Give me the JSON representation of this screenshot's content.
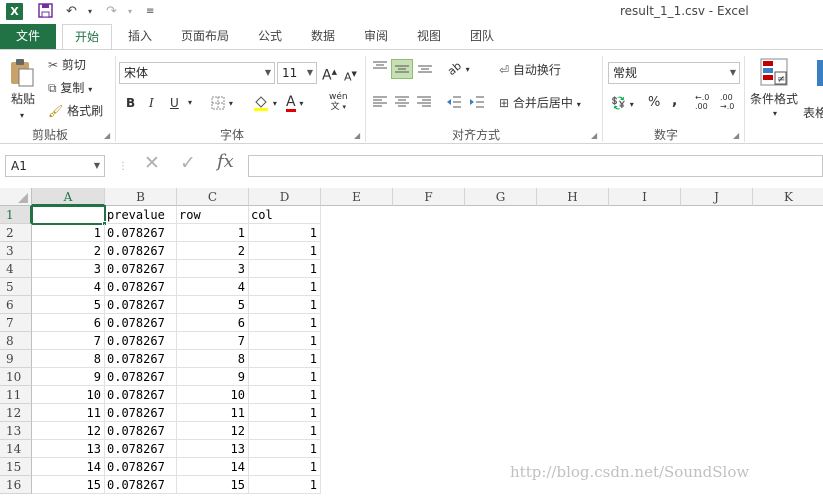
{
  "window_title": "result_1_1.csv - Excel",
  "app_icon": "X",
  "tabs": [
    "文件",
    "开始",
    "插入",
    "页面布局",
    "公式",
    "数据",
    "审阅",
    "视图",
    "团队"
  ],
  "clipboard": {
    "paste": "粘贴",
    "cut": "剪切",
    "copy": "复制",
    "format_painter": "格式刷",
    "label": "剪贴板"
  },
  "font": {
    "name": "宋体",
    "size": "11",
    "label": "字体",
    "bold": "B",
    "italic": "I",
    "underline": "U",
    "phonetic": "wén"
  },
  "alignment": {
    "wrap": "自动换行",
    "merge": "合并后居中",
    "label": "对齐方式"
  },
  "number": {
    "format": "常规",
    "label": "数字",
    "percent": "%",
    "comma": ","
  },
  "styles": {
    "conditional": "条件格式",
    "table": "表格"
  },
  "formula_bar": {
    "name_box": "A1",
    "fx": "fx",
    "value": ""
  },
  "columns": [
    "A",
    "B",
    "C",
    "D",
    "E",
    "F",
    "G",
    "H",
    "I",
    "J",
    "K"
  ],
  "header_row": {
    "row": "1",
    "a": "",
    "b": "prevalue",
    "c": "row",
    "d": "col"
  },
  "rows": [
    {
      "row": "2",
      "a": "1",
      "b": "0.078267",
      "c": "1",
      "d": "1"
    },
    {
      "row": "3",
      "a": "2",
      "b": "0.078267",
      "c": "2",
      "d": "1"
    },
    {
      "row": "4",
      "a": "3",
      "b": "0.078267",
      "c": "3",
      "d": "1"
    },
    {
      "row": "5",
      "a": "4",
      "b": "0.078267",
      "c": "4",
      "d": "1"
    },
    {
      "row": "6",
      "a": "5",
      "b": "0.078267",
      "c": "5",
      "d": "1"
    },
    {
      "row": "7",
      "a": "6",
      "b": "0.078267",
      "c": "6",
      "d": "1"
    },
    {
      "row": "8",
      "a": "7",
      "b": "0.078267",
      "c": "7",
      "d": "1"
    },
    {
      "row": "9",
      "a": "8",
      "b": "0.078267",
      "c": "8",
      "d": "1"
    },
    {
      "row": "10",
      "a": "9",
      "b": "0.078267",
      "c": "9",
      "d": "1"
    },
    {
      "row": "11",
      "a": "10",
      "b": "0.078267",
      "c": "10",
      "d": "1"
    },
    {
      "row": "12",
      "a": "11",
      "b": "0.078267",
      "c": "11",
      "d": "1"
    },
    {
      "row": "13",
      "a": "12",
      "b": "0.078267",
      "c": "12",
      "d": "1"
    },
    {
      "row": "14",
      "a": "13",
      "b": "0.078267",
      "c": "13",
      "d": "1"
    },
    {
      "row": "15",
      "a": "14",
      "b": "0.078267",
      "c": "14",
      "d": "1"
    },
    {
      "row": "16",
      "a": "15",
      "b": "0.078267",
      "c": "15",
      "d": "1"
    }
  ],
  "watermark": "http://blog.csdn.net/SoundSlow",
  "colors": {
    "accent": "#217346"
  }
}
